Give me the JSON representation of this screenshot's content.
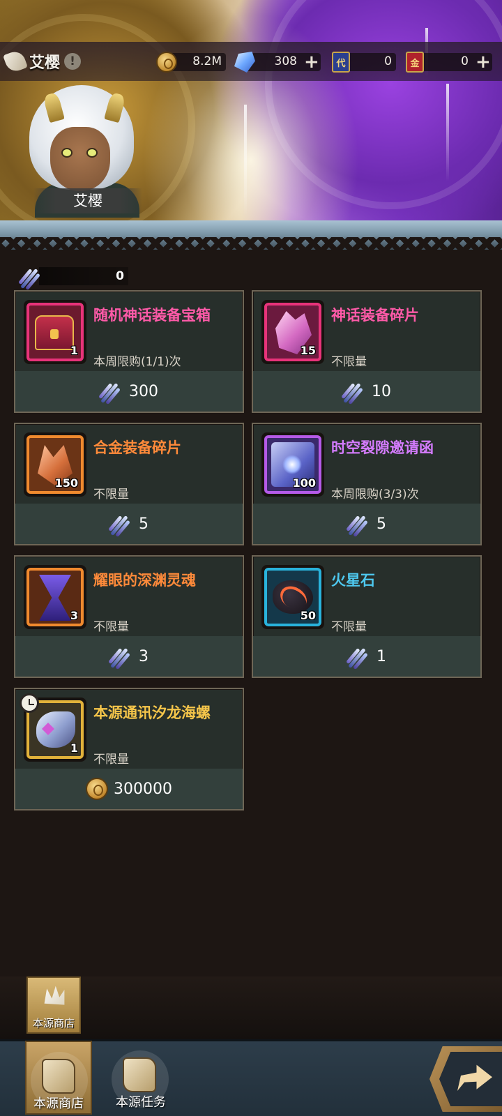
{
  "header": {
    "player_name": "艾樱",
    "info_icon": "!",
    "currencies": [
      {
        "icon": "gold-coin-icon",
        "value": "8.2M",
        "has_plus": false
      },
      {
        "icon": "crystal-icon",
        "value": "308",
        "has_plus": true
      },
      {
        "icon": "card-dai-icon",
        "badge": "代",
        "value": "0",
        "has_plus": false
      },
      {
        "icon": "card-jin-icon",
        "badge": "金",
        "value": "0",
        "has_plus": true
      }
    ],
    "plus": "+"
  },
  "portrait": {
    "label": "艾樱"
  },
  "balance": {
    "icon": "arrow-fragment-icon",
    "value": "0"
  },
  "items": [
    {
      "title": "随机神话装备宝箱",
      "limit": "本周限购(1/1)次",
      "qty": "1",
      "price": "300",
      "currency": "arrow-fragment-icon",
      "title_color": "#ff5aa8",
      "frame_color": "#e8337a"
    },
    {
      "title": "神话装备碎片",
      "limit": "不限量",
      "qty": "15",
      "price": "10",
      "currency": "arrow-fragment-icon",
      "title_color": "#ff5aa8",
      "frame_color": "#e8337a"
    },
    {
      "title": "合金装备碎片",
      "limit": "不限量",
      "qty": "150",
      "price": "5",
      "currency": "arrow-fragment-icon",
      "title_color": "#ff8a3a",
      "frame_color": "#f08a2e"
    },
    {
      "title": "时空裂隙邀请函",
      "limit": "本周限购(3/3)次",
      "qty": "100",
      "price": "5",
      "currency": "arrow-fragment-icon",
      "title_color": "#d57cff",
      "frame_color": "#b55ae8"
    },
    {
      "title": "耀眼的深渊灵魂",
      "limit": "不限量",
      "qty": "3",
      "price": "3",
      "currency": "arrow-fragment-icon",
      "title_color": "#ff8a3a",
      "frame_color": "#f08a2e"
    },
    {
      "title": "火星石",
      "limit": "不限量",
      "qty": "50",
      "price": "1",
      "currency": "arrow-fragment-icon",
      "title_color": "#4ec9f0",
      "frame_color": "#29b3dc"
    },
    {
      "title": "本源通讯汐龙海螺",
      "limit": "不限量",
      "qty": "1",
      "price": "300000",
      "currency": "gold-coin-icon",
      "title_color": "#f5c54a",
      "frame_color": "#e2b23a"
    }
  ],
  "sub_tab": {
    "label": "本源商店",
    "icon": "shop-icon"
  },
  "nav": [
    {
      "label": "本源商店",
      "icon": "scroll-icon",
      "active": true
    },
    {
      "label": "本源任务",
      "icon": "scroll-icon",
      "active": false
    }
  ],
  "forward_icon": "share-arrow-icon"
}
